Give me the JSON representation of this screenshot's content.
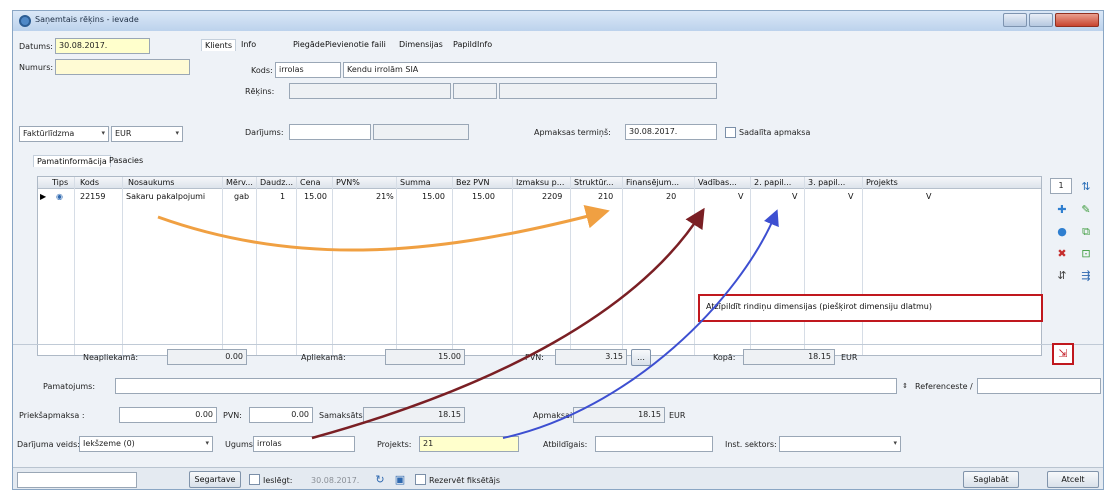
{
  "window": {
    "title": "Saņemtais rēķins - ievade"
  },
  "header": {
    "datums_label": "Datums:",
    "datums_value": "30.08.2017.",
    "numurs_label": "Numurs:",
    "numurs_value": "",
    "pay_type": "Faktūrlīdzma",
    "currency": "EUR",
    "tabs": [
      "Klients",
      "Info",
      "Piegāde",
      "Pievienotie faili",
      "Dimensijas",
      "PapildInfo"
    ],
    "kods_label": "Kods:",
    "kods_value": "irrolas",
    "client_name": "Kendu irrolām SIA",
    "rekins_label": "Rēķins:",
    "darijums_label": "Darījums:",
    "apmaksas_label": "Apmaksas termiņš:",
    "apmaksas_value": "30.08.2017.",
    "sadalita_label": "Sadalīta apmaksa"
  },
  "subtabs": [
    "Pamatinformācija",
    "Pasacies"
  ],
  "grid": {
    "columns": [
      "Tips",
      "Kods",
      "Nosaukums",
      "Mērv...",
      "Daudz...",
      "Cena",
      "PVN%",
      "Summa",
      "Bez PVN",
      "Izmaksu p...",
      "Struktūr...",
      "Finansējum...",
      "Vadības...",
      "2. papil...",
      "3. papil...",
      "Projekts"
    ],
    "row": [
      "22159",
      "Sakaru pakalpojumi",
      "gab",
      "1",
      "15.00",
      "21%",
      "15.00",
      "15.00",
      "2209",
      "210",
      "20",
      "V",
      "V",
      "V",
      "V"
    ]
  },
  "side": {
    "page_number": "1"
  },
  "callout": {
    "text": "Atzīpildīt rindiņu dimensijas (piešķirot dimensiju dlatmu)"
  },
  "totals": {
    "neapliekamo_label": "Neapliekamā:",
    "neapliekamo_value": "0.00",
    "apliekamo_label": "Apliekamā:",
    "apliekamo_value": "15.00",
    "pvn_label": "PVN:",
    "pvn_value": "3.15",
    "kopa_label": "Kopā:",
    "kopa_value": "18.15",
    "currency": "EUR",
    "pamatojums_label": "Pamatojums:",
    "references_label": "Referenceste /",
    "prieksapmaksa_label": "Priekšapmaksa :",
    "prieksapmaksa_value": "0.00",
    "pvn2_label": "PVN:",
    "pvn2_value": "0.00",
    "samaksats_label": "Samaksāts:",
    "samaksats_value": "18.15",
    "apmaksai_label": "Apmaksai:",
    "apmaksai_value": "18.15",
    "currency2": "EUR"
  },
  "bottom": {
    "darijuma_veids_label": "Darījuma veids:",
    "darijuma_veids_value": "Iekšzeme (0)",
    "uguns_label": "Ugums:",
    "uguns_value": "irrolas",
    "projekts_label": "Projekts:",
    "projekts_value": "21",
    "atbildigais_label": "Atbildīgais:",
    "inst_sektors_label": "Inst. sektors:"
  },
  "status": {
    "segmented": "Segartave",
    "ieslegt_label": "Ieslēgt:",
    "ieslegt_date": "30.08.2017.",
    "rezerves_label": "Rezervēt fiksētājs",
    "save_label": "Saglabāt",
    "cancel_label": "Atcelt"
  },
  "colors": {
    "orange_arrow": "#f0a042",
    "red_arrow": "#7a1f24",
    "blue_arrow": "#3d4fd1",
    "callout_border": "#c0181e"
  }
}
